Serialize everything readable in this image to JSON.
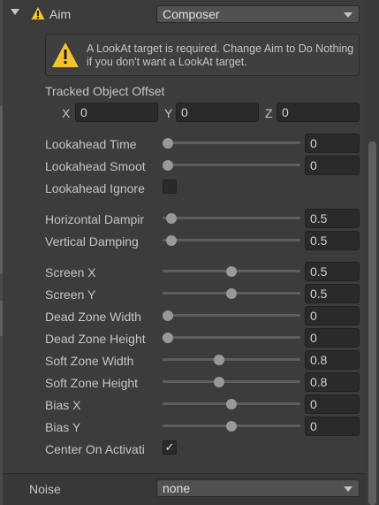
{
  "aim": {
    "label": "Aim",
    "value": "Composer"
  },
  "help": {
    "text": "A LookAt target is required.  Change Aim to Do Nothing if you don't want a LookAt target."
  },
  "tracked_offset": {
    "label": "Tracked Object Offset",
    "x_label": "X",
    "x": "0",
    "y_label": "Y",
    "y": "0",
    "z_label": "Z",
    "z": "0"
  },
  "lookahead_time": {
    "label": "Lookahead Time",
    "value": "0",
    "fraction": 0
  },
  "lookahead_smoothing": {
    "label": "Lookahead Smoot",
    "value": "0",
    "fraction": 0
  },
  "lookahead_ignore": {
    "label": "Lookahead Ignore",
    "checked": false
  },
  "horizontal_damping": {
    "label": "Horizontal Dampir",
    "value": "0.5",
    "fraction": 0.025
  },
  "vertical_damping": {
    "label": "Vertical Damping",
    "value": "0.5",
    "fraction": 0.025
  },
  "screen_x": {
    "label": "Screen X",
    "value": "0.5",
    "fraction": 0.5
  },
  "screen_y": {
    "label": "Screen Y",
    "value": "0.5",
    "fraction": 0.5
  },
  "dead_zone_width": {
    "label": "Dead Zone Width",
    "value": "0",
    "fraction": 0
  },
  "dead_zone_height": {
    "label": "Dead Zone Height",
    "value": "0",
    "fraction": 0
  },
  "soft_zone_width": {
    "label": "Soft Zone Width",
    "value": "0.8",
    "fraction": 0.4
  },
  "soft_zone_height": {
    "label": "Soft Zone Height",
    "value": "0.8",
    "fraction": 0.4
  },
  "bias_x": {
    "label": "Bias X",
    "value": "0",
    "fraction": 0.5
  },
  "bias_y": {
    "label": "Bias Y",
    "value": "0",
    "fraction": 0.5
  },
  "center_on_activate": {
    "label": "Center On Activati",
    "checked": true,
    "check_glyph": "✓"
  },
  "noise": {
    "label": "Noise",
    "value": "none"
  },
  "icons": {
    "warning": "warning-icon",
    "foldout": "foldout-arrow-icon",
    "dropdown": "chevron-down-icon"
  },
  "colors": {
    "warning_yellow": "#f4c430",
    "panel_bg": "#3c3c3c",
    "field_bg": "#2a2a2a",
    "knob": "#999999"
  }
}
